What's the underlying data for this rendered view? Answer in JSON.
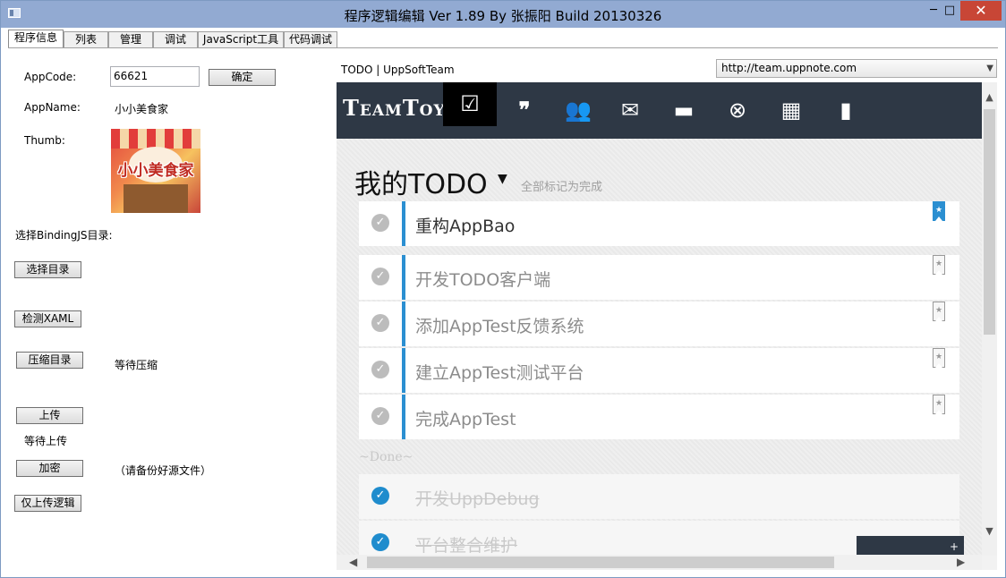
{
  "window": {
    "title": "程序逻辑编辑 Ver 1.89 By 张振阳 Build 20130326",
    "minimize": "─",
    "maximize": "□",
    "close": "✕"
  },
  "tabs": [
    "程序信息",
    "列表",
    "管理",
    "调试",
    "JavaScript工具",
    "代码调试"
  ],
  "left": {
    "appcode_label": "AppCode:",
    "appcode_value": "66621",
    "confirm_button": "确定",
    "appname_label": "AppName:",
    "appname_value": "小小美食家",
    "thumb_label": "Thumb:",
    "thumb_text": "小小美食家",
    "binding_label": "选择BindingJS目录:",
    "select_dir_button": "选择目录",
    "check_xaml_button": "检测XAML",
    "compress_button": "压缩目录",
    "compress_status": "等待压缩",
    "upload_button": "上传",
    "upload_status": "等待上传",
    "encrypt_button": "加密",
    "encrypt_note": "（请备份好源文件）",
    "upload_logic_button": "仅上传逻辑"
  },
  "browser": {
    "page_label": "TODO | UppSoftTeam",
    "url": "http://team.uppnote.com",
    "logo": "TeamToy",
    "nav_icons": [
      "todo-icon",
      "quote-icon",
      "people-icon",
      "mail-icon",
      "briefcase-icon",
      "close-circle-icon",
      "calendar-icon",
      "stats-icon"
    ],
    "heading": "我的TODO",
    "mark_all": "全部标记为完成",
    "todos": [
      "重构AppBao",
      "开发TODO客户端",
      "添加AppTest反馈系统",
      "建立AppTest测试平台",
      "完成AppTest"
    ],
    "done_label": "~Done~",
    "done_items": [
      "开发UppDebug",
      "平台整合维护"
    ],
    "add_button": "+",
    "colors": {
      "navbar": "#2e3845",
      "accent": "#2b8fd1"
    }
  }
}
